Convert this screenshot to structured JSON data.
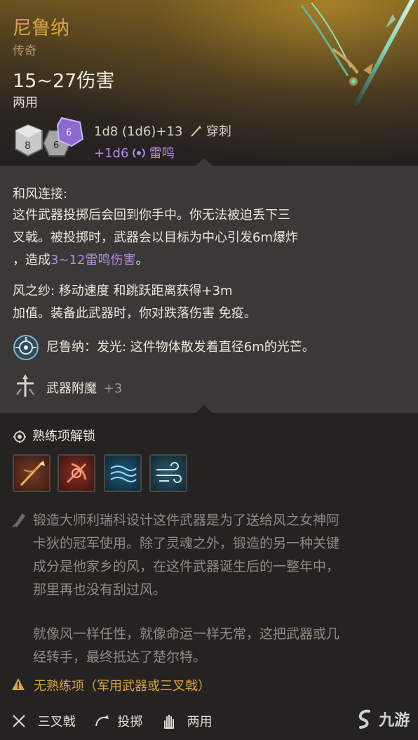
{
  "item": {
    "name": "尼鲁纳",
    "rarity": "传奇",
    "damage": "15~27伤害",
    "handedness": "两用",
    "dice_formula": "1d8 (1d6)+13",
    "damage_type": "穿刺",
    "bonus_damage": "+1d6",
    "bonus_type": "雷鸣"
  },
  "abilities": {
    "recall": {
      "title": "和风连接:",
      "line1": "这件武器投掷后会回到你手中。你无法被迫丢下三",
      "line2": "叉戟。被投掷时，武器会以目标为中心引发6m爆炸",
      "line3_prefix": "，造成",
      "line3_highlight": "3~12雷鸣伤害",
      "line3_suffix": "。"
    },
    "wind": {
      "line1": "风之纱: 移动速度 和跳跃距离获得+3m",
      "line2": "加值。装备此武器时，你对跌落伤害 免疫。"
    },
    "light": {
      "text": "尼鲁纳：发光: 这件物体散发着直径6m的光芒。"
    },
    "enchant": {
      "label": "武器附魔",
      "value": "+3"
    }
  },
  "proficiency": {
    "title": "熟练项解锁",
    "skills": [
      "spear-thrust-skill",
      "cleave-skill",
      "wind-wave-skill",
      "gust-skill"
    ]
  },
  "lore": {
    "p1_line1": "锻造大师利瑞科设计这件武器是为了送给风之女神阿",
    "p1_line2": "卡狄的冠军使用。除了灵魂之外，锻造的另一种关键",
    "p1_line3": "成分是他家乡的风，在这件武器诞生后的一整年中，",
    "p1_line4": "那里再也没有刮过风。",
    "p2_line1": "就像风一样任性，就像命运一样无常，这把武器或几",
    "p2_line2": "经转手，最终抵达了楚尔特。"
  },
  "warning": {
    "text": "无熟练项（军用武器或三叉戟）"
  },
  "footer": {
    "type": "三叉戟",
    "thrown": "投掷",
    "hands": "两用"
  },
  "watermark": {
    "text": "九游"
  },
  "colors": {
    "gold": "#d9a441",
    "purple": "#b488e8",
    "panel_light": "#3a3937",
    "panel_dark": "#242321"
  }
}
